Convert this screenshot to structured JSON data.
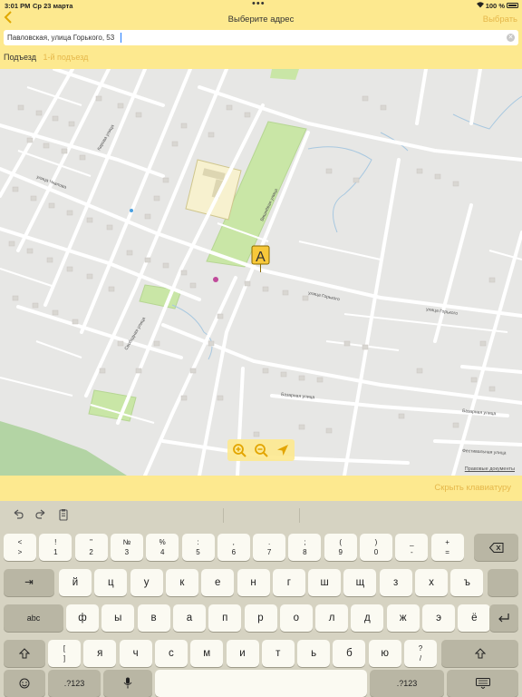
{
  "status": {
    "time": "3:01 PM",
    "date": "Ср 23 марта",
    "battery": "100 %"
  },
  "navbar": {
    "back_icon": "chevron-left-icon",
    "title": "Выберите адрес",
    "action": "Выбрать"
  },
  "address": {
    "value": "Павловская, улица Горького, 53",
    "clear_icon": "clear-icon"
  },
  "entrance": {
    "label": "Подъезд",
    "value": "1-й подъезд"
  },
  "map": {
    "marker_label": "A",
    "controls": [
      "zoom-in-icon",
      "zoom-out-icon",
      "locate-icon"
    ],
    "legal": "Правовые документы",
    "street_labels": [
      "улица Горького",
      "улица Горького",
      "Вишнёвая улица",
      "Базарная улица",
      "Базарная улица",
      "Фестивальная улица",
      "Свободная улица",
      "улица Чкалова",
      "Кирова улица"
    ]
  },
  "hide_keyboard": "Скрыть клавиатуру",
  "keyboard": {
    "toolbar": [
      "undo-icon",
      "redo-icon",
      "paste-icon"
    ],
    "row_numbers": [
      {
        "top": "<",
        "bottom": ">"
      },
      {
        "top": "!",
        "bottom": "1"
      },
      {
        "top": "\"",
        "bottom": "2"
      },
      {
        "top": "№",
        "bottom": "3"
      },
      {
        "top": "%",
        "bottom": "4"
      },
      {
        "top": ":",
        "bottom": "5"
      },
      {
        "top": ",",
        "bottom": "6"
      },
      {
        "top": ".",
        "bottom": "7"
      },
      {
        "top": ";",
        "bottom": "8"
      },
      {
        "top": "(",
        "bottom": "9"
      },
      {
        "top": ")",
        "bottom": "0"
      },
      {
        "top": "_",
        "bottom": "-"
      },
      {
        "top": "+",
        "bottom": "="
      }
    ],
    "row1": [
      "й",
      "ц",
      "у",
      "к",
      "е",
      "н",
      "г",
      "ш",
      "щ",
      "з",
      "х",
      "ъ"
    ],
    "row2": [
      "ф",
      "ы",
      "в",
      "а",
      "п",
      "р",
      "о",
      "л",
      "д",
      "ж",
      "э",
      "ё"
    ],
    "row3": [
      "[\n]",
      "я",
      "ч",
      "с",
      "м",
      "и",
      "т",
      "ь",
      "б",
      "ю",
      "?\n/"
    ],
    "tab": "⇥",
    "caps": "abc",
    "delete_icon": "delete-icon",
    "return_icon": "return-icon",
    "shift_icon": "shift-icon",
    "emoji_icon": "emoji-icon",
    "mic_icon": "microphone-icon",
    "hide_icon": "keyboard-hide-icon",
    "numbers": ".?123"
  },
  "colors": {
    "header": "#fde98f",
    "accent": "#e5b74a",
    "park": "#c9e6a6",
    "forest": "#a9cc9a"
  }
}
